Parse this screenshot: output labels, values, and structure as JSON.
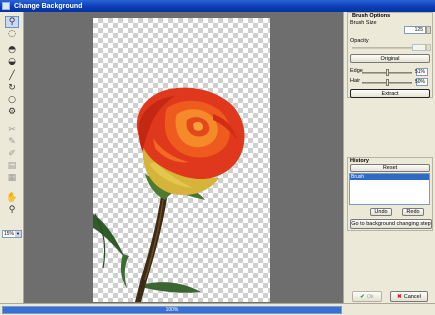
{
  "window": {
    "title": "Change Background"
  },
  "toolbar": {
    "tools": [
      {
        "name": "zoom-tool-icon",
        "glyph": "⚲",
        "selected": true,
        "enabled": true
      },
      {
        "name": "lasso-tool-icon",
        "glyph": "◌",
        "selected": false,
        "enabled": true
      },
      {
        "name": "keep-area-brush-icon",
        "glyph": "◓",
        "selected": false,
        "enabled": true
      },
      {
        "name": "remove-area-brush-icon",
        "glyph": "◒",
        "selected": false,
        "enabled": true
      },
      {
        "name": "line-tool-icon",
        "glyph": "╱",
        "selected": false,
        "enabled": true
      },
      {
        "name": "rotate-tool-icon",
        "glyph": "↻",
        "selected": false,
        "enabled": true
      },
      {
        "name": "circle-tool-icon",
        "glyph": "○",
        "selected": false,
        "enabled": true
      },
      {
        "name": "settings-tool-icon",
        "glyph": "⚙",
        "selected": false,
        "enabled": true
      },
      {
        "name": "scissors-tool-icon",
        "glyph": "✂",
        "selected": false,
        "enabled": false
      },
      {
        "name": "brush-keep-tool-icon",
        "glyph": "✎",
        "selected": false,
        "enabled": false
      },
      {
        "name": "brush-erase-tool-icon",
        "glyph": "✐",
        "selected": false,
        "enabled": false
      },
      {
        "name": "layer-tool-icon",
        "glyph": "▤",
        "selected": false,
        "enabled": false
      },
      {
        "name": "stamp-tool-icon",
        "glyph": "▦",
        "selected": false,
        "enabled": false
      },
      {
        "name": "hand-tool-icon",
        "glyph": "✋",
        "selected": false,
        "enabled": true
      },
      {
        "name": "magnifier-tool-icon",
        "glyph": "⚲",
        "selected": false,
        "enabled": true
      }
    ],
    "zoom_value": "15%"
  },
  "panel": {
    "brush_options": {
      "title": "Brush Options",
      "brush_size_label": "Brush Size",
      "brush_size_value": "125",
      "opacity_label": "Opacity",
      "original_button": "Original",
      "edge_label": "Edge",
      "edge_value": "51%",
      "edge_level": 0.51,
      "hair_label": "Hair",
      "hair_value": "50%",
      "hair_level": 0.5,
      "extract_button": "Extract"
    },
    "history": {
      "title": "History",
      "reset_button": "Reset",
      "items": [
        "Brush"
      ],
      "undo_button": "Undo",
      "redo_button": "Redo",
      "go_button": "Go to background changing step"
    },
    "footer": {
      "ok_button": "Ok",
      "cancel_button": "Cancel"
    }
  },
  "status": {
    "progress_text": "100%",
    "progress_level": 1.0
  },
  "colors": {
    "title_bar": "#0a3cb5",
    "panel_bg": "#ece9d8",
    "workspace_bg": "#6e6e6e",
    "progress_fill": "#3a6fd8",
    "selection": "#316ac5"
  }
}
